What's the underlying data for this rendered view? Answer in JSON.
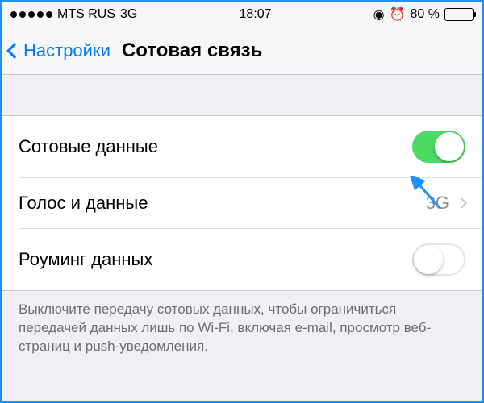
{
  "status": {
    "carrier": "MTS RUS",
    "network": "3G",
    "time": "18:07",
    "battery_pct": "80 %"
  },
  "nav": {
    "back_label": "Настройки",
    "title": "Сотовая связь"
  },
  "rows": {
    "cellular_data": {
      "label": "Сотовые данные"
    },
    "voice_data": {
      "label": "Голос и данные",
      "value": "3G"
    },
    "data_roaming": {
      "label": "Роуминг данных"
    }
  },
  "footer": "Выключите передачу сотовых данных, чтобы ограничиться передачей данных лишь по Wi-Fi, включая e-mail, просмотр веб-страниц и push-уведомления."
}
